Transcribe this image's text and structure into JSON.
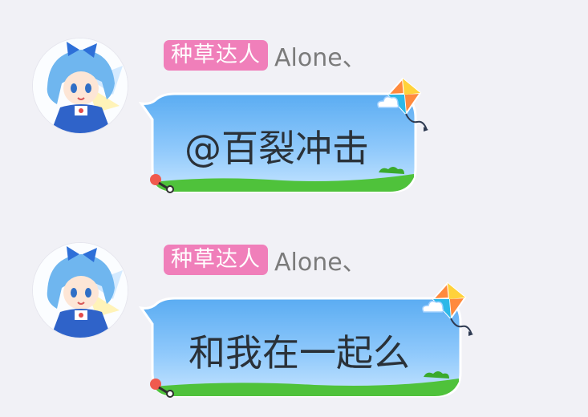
{
  "messages": [
    {
      "badge": "种草达人",
      "nickname": "Alone、",
      "text": "@百裂冲击"
    },
    {
      "badge": "种草达人",
      "nickname": "Alone、",
      "text": "和我在一起么"
    }
  ],
  "colors": {
    "background": "#f1f1f6",
    "badge": "#f07fba",
    "bubble_top": "#5aacf2",
    "bubble_bottom": "#c4e4ff",
    "grass": "#4fc23b",
    "nickname": "#7b7b7b"
  },
  "icons": [
    "avatar-anime-girl",
    "kite-icon",
    "cloud-icon",
    "pin-icon",
    "grass-decoration"
  ]
}
